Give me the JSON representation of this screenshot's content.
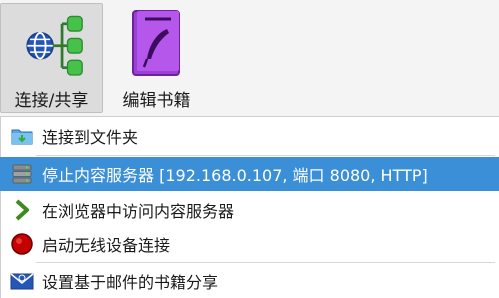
{
  "toolbar": {
    "buttons": [
      {
        "label": "连接/共享",
        "icon": "network-share-icon",
        "active": true
      },
      {
        "label": "编辑书籍",
        "icon": "edit-book-icon",
        "active": false
      }
    ]
  },
  "menu": {
    "items": [
      {
        "label": "连接到文件夹",
        "icon": "folder-icon"
      },
      {
        "label": "停止内容服务器 [192.168.0.107, 端口 8080, HTTP]",
        "icon": "server-icon",
        "highlighted": true
      },
      {
        "label": "在浏览器中访问内容服务器",
        "icon": "chevron-right-icon"
      },
      {
        "label": "启动无线设备连接",
        "icon": "red-circle-icon"
      },
      {
        "label": "设置基于邮件的书籍分享",
        "icon": "mail-icon"
      }
    ]
  },
  "colors": {
    "highlight": "#3a8fd6",
    "active_button": "#dcdcdc"
  }
}
